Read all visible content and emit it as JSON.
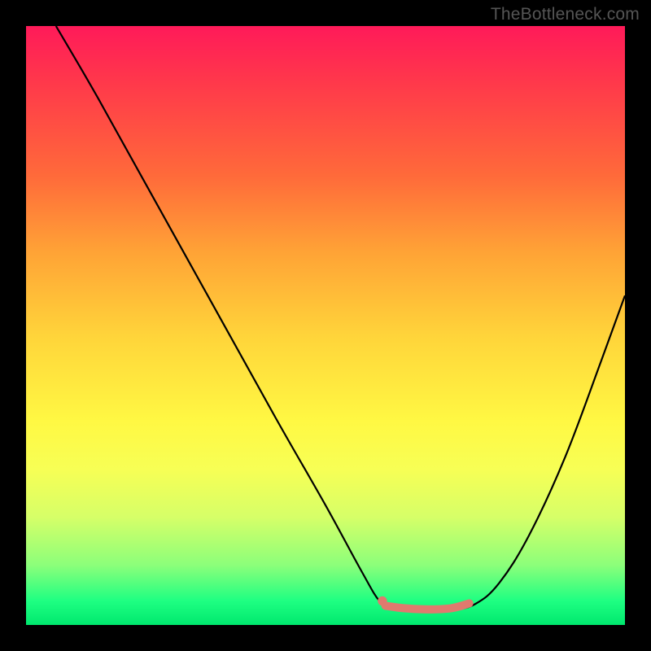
{
  "chart_data": {
    "type": "line",
    "title": "",
    "watermark": "TheBottleneck.com",
    "xlabel": "",
    "ylabel": "",
    "xlim": [
      0,
      100
    ],
    "ylim": [
      0,
      100
    ],
    "background_gradient_stops": [
      {
        "pos": 0,
        "color": "#ff1a59"
      },
      {
        "pos": 10,
        "color": "#ff3a4a"
      },
      {
        "pos": 25,
        "color": "#ff6a3a"
      },
      {
        "pos": 38,
        "color": "#ffa436"
      },
      {
        "pos": 52,
        "color": "#ffd53a"
      },
      {
        "pos": 66,
        "color": "#fff843"
      },
      {
        "pos": 74,
        "color": "#f7ff55"
      },
      {
        "pos": 82,
        "color": "#d6ff68"
      },
      {
        "pos": 90,
        "color": "#8cff7a"
      },
      {
        "pos": 96,
        "color": "#1eff82"
      },
      {
        "pos": 100,
        "color": "#00e86e"
      }
    ],
    "series": [
      {
        "name": "bottleneck-curve",
        "stroke": "#000000",
        "stroke_width": 2.2,
        "points": [
          {
            "x": 5,
            "y": 100
          },
          {
            "x": 12,
            "y": 88
          },
          {
            "x": 22,
            "y": 70
          },
          {
            "x": 32,
            "y": 52
          },
          {
            "x": 42,
            "y": 34
          },
          {
            "x": 50,
            "y": 20
          },
          {
            "x": 56,
            "y": 9
          },
          {
            "x": 59,
            "y": 4
          },
          {
            "x": 61,
            "y": 3
          },
          {
            "x": 66,
            "y": 2.5
          },
          {
            "x": 71,
            "y": 2.5
          },
          {
            "x": 75,
            "y": 3.5
          },
          {
            "x": 79,
            "y": 7
          },
          {
            "x": 84,
            "y": 15
          },
          {
            "x": 90,
            "y": 28
          },
          {
            "x": 96,
            "y": 44
          },
          {
            "x": 100,
            "y": 55
          }
        ]
      }
    ],
    "highlight": {
      "name": "optimal-range",
      "stroke": "#e07a6e",
      "stroke_width": 10,
      "points": [
        {
          "x": 60,
          "y": 3.2
        },
        {
          "x": 63,
          "y": 2.8
        },
        {
          "x": 67,
          "y": 2.6
        },
        {
          "x": 71,
          "y": 2.8
        },
        {
          "x": 74,
          "y": 3.6
        }
      ],
      "dot": {
        "x": 59.5,
        "y": 4,
        "r": 5.5
      }
    }
  }
}
